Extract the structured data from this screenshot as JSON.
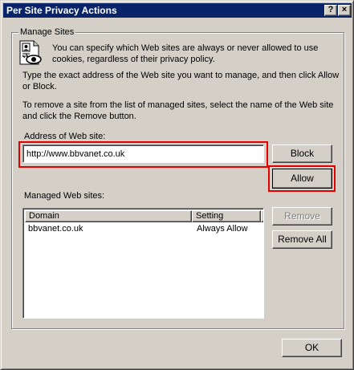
{
  "window": {
    "title": "Per Site Privacy Actions",
    "help_button": "?",
    "close_button": "×"
  },
  "group": {
    "label": "Manage Sites",
    "icon": "privacy-document-eye-icon",
    "intro": "You can specify which Web sites are always or never allowed to use cookies, regardless of their privacy policy.",
    "instructions_manage": "Type the exact address of the Web site you want to manage, and then click Allow or Block.",
    "instructions_remove": "To remove a site from the list of managed sites, select the name of the Web site and click the Remove button."
  },
  "address": {
    "label": "Address of Web site:",
    "value": "http://www.bbvanet.co.uk"
  },
  "buttons": {
    "block": "Block",
    "allow": "Allow",
    "remove": "Remove",
    "remove_all": "Remove All",
    "ok": "OK"
  },
  "managed": {
    "label": "Managed Web sites:",
    "columns": [
      "Domain",
      "Setting"
    ],
    "rows": [
      {
        "domain": "bbvanet.co.uk",
        "setting": "Always Allow"
      }
    ]
  },
  "colors": {
    "titlebar": "#0a246a",
    "face": "#d4d0c8",
    "highlight_annotation": "#e00000"
  }
}
